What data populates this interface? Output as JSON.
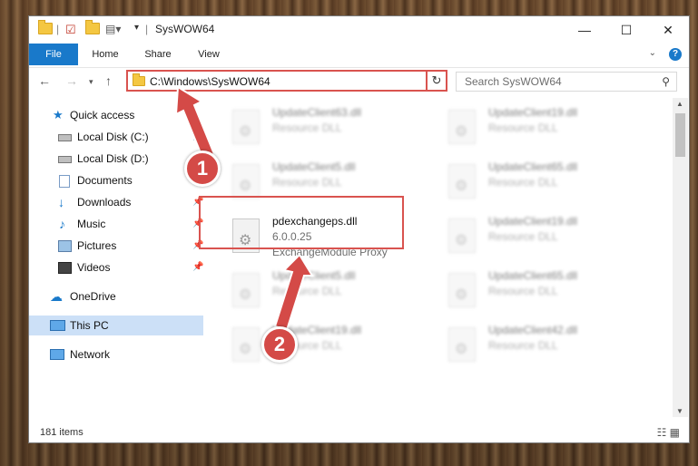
{
  "window": {
    "title": "SysWOW64"
  },
  "ribbon": {
    "tabs": [
      "File",
      "Home",
      "Share",
      "View"
    ]
  },
  "nav": {
    "address": "C:\\Windows\\SysWOW64",
    "search_placeholder": "Search SysWOW64"
  },
  "sidebar": {
    "items": [
      {
        "label": "Quick access",
        "icon": "star-icon"
      },
      {
        "label": "Local Disk (C:)",
        "icon": "drive-icon"
      },
      {
        "label": "Local Disk (D:)",
        "icon": "drive-icon"
      },
      {
        "label": "Documents",
        "icon": "documents-icon"
      },
      {
        "label": "Downloads",
        "icon": "download-icon"
      },
      {
        "label": "Music",
        "icon": "music-icon"
      },
      {
        "label": "Pictures",
        "icon": "pictures-icon"
      },
      {
        "label": "Videos",
        "icon": "videos-icon"
      },
      {
        "label": "OneDrive",
        "icon": "cloud-icon"
      },
      {
        "label": "This PC",
        "icon": "computer-icon"
      },
      {
        "label": "Network",
        "icon": "network-icon"
      }
    ]
  },
  "files": [
    {
      "name": "UpdateClient63.dll",
      "type": "Resource DLL"
    },
    {
      "name": "UpdateClient19.dll",
      "type": "Resource DLL"
    },
    {
      "name": "UpdateClient5.dll",
      "type": "Resource DLL"
    },
    {
      "name": "UpdateClient65.dll",
      "type": "Resource DLL"
    },
    {
      "name": "pdexchangeps.dll",
      "version": "6.0.0.25",
      "type": "ExchangeModule Proxy"
    },
    {
      "name": "UpdateClient19.dll",
      "type": "Resource DLL"
    },
    {
      "name": "UpdateClient5.dll",
      "type": "Resource DLL"
    },
    {
      "name": "UpdateClient65.dll",
      "type": "Resource DLL"
    },
    {
      "name": "UpdateClient19.dll",
      "type": "Resource DLL"
    },
    {
      "name": "UpdateClient42.dll",
      "type": "Resource DLL"
    }
  ],
  "status": {
    "item_count": "181 items"
  },
  "annotations": {
    "step1": "1",
    "step2": "2"
  },
  "colors": {
    "accent": "#1979ca",
    "highlight": "#d9534f",
    "selected": "#cce0f7"
  }
}
